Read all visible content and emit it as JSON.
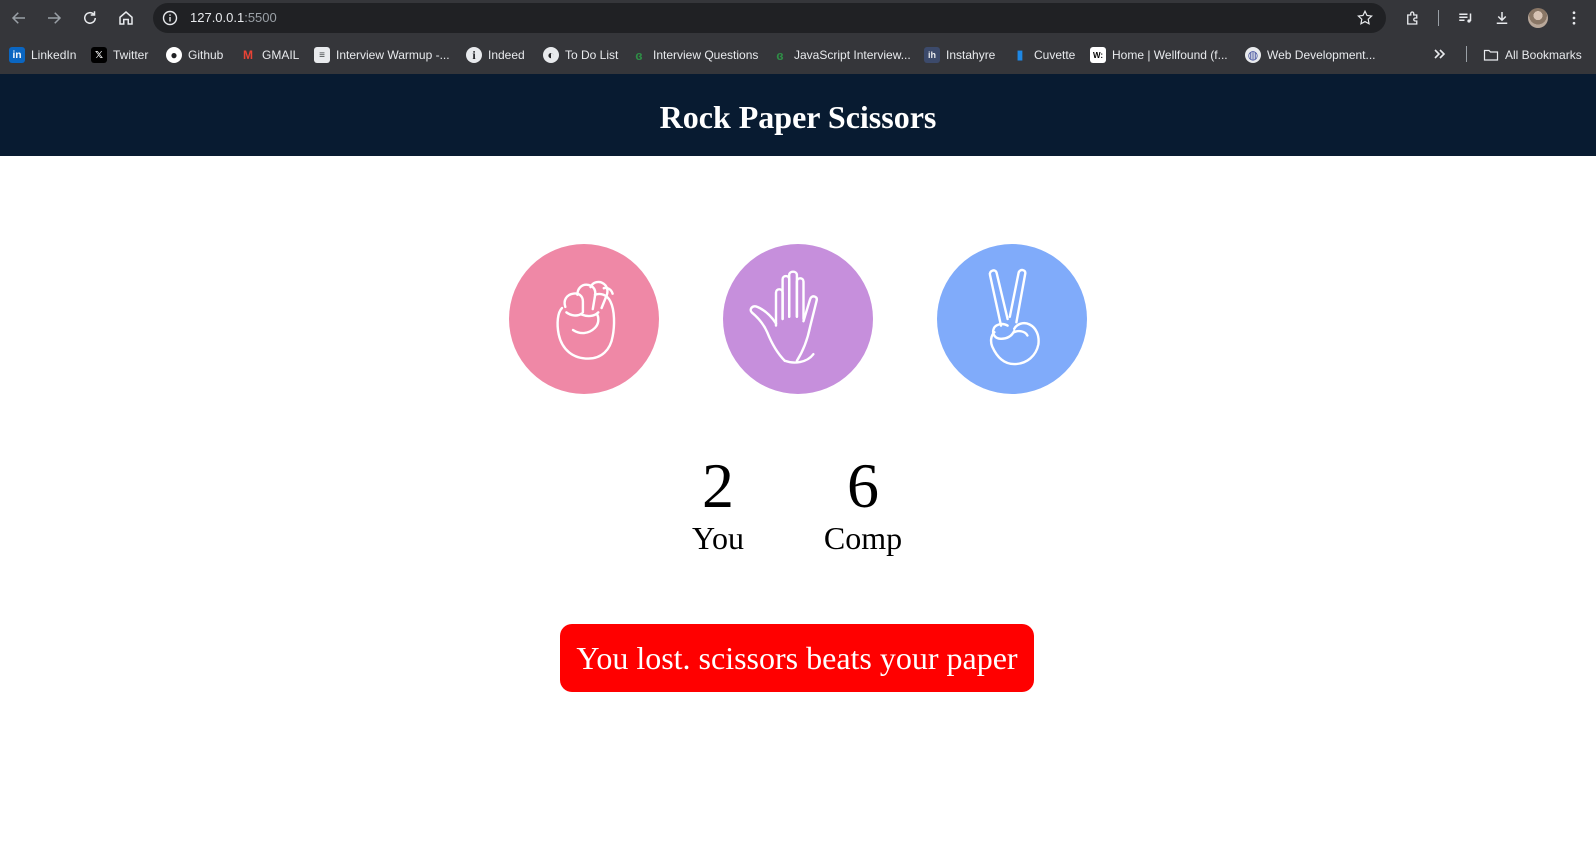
{
  "browser": {
    "url_host": "127.0.0.1",
    "url_port": ":5500",
    "bookmarks": [
      {
        "label": "LinkedIn",
        "icon": "linkedin-icon",
        "color": "#0a66c2",
        "glyph": "in"
      },
      {
        "label": "Twitter",
        "icon": "x-twitter-icon",
        "color": "#000000",
        "glyph": "𝕏"
      },
      {
        "label": "Github",
        "icon": "github-icon",
        "color": "#ffffff",
        "glyph": "●"
      },
      {
        "label": "GMAIL",
        "icon": "gmail-icon",
        "color": "#ea4335",
        "glyph": "M"
      },
      {
        "label": "Interview Warmup -...",
        "icon": "doc-icon",
        "color": "#e8eaed",
        "glyph": "≡"
      },
      {
        "label": "Indeed",
        "icon": "info-circle-icon",
        "color": "#e8eaed",
        "glyph": "i"
      },
      {
        "label": "To Do List",
        "icon": "globe-icon",
        "color": "#e8eaed",
        "glyph": "◐"
      },
      {
        "label": "Interview Questions",
        "icon": "gfg-icon",
        "color": "#2f8d46",
        "glyph": "ɞ"
      },
      {
        "label": "JavaScript Interview...",
        "icon": "gfg-icon",
        "color": "#2f8d46",
        "glyph": "ɞ"
      },
      {
        "label": "Instahyre",
        "icon": "instahyre-icon",
        "color": "#3c4a6b",
        "glyph": "ih"
      },
      {
        "label": "Cuvette",
        "icon": "cuvette-icon",
        "color": "#1565c0",
        "glyph": "▮"
      },
      {
        "label": "Home | Wellfound (f...",
        "icon": "wellfound-icon",
        "color": "#ffffff",
        "glyph": "W:"
      },
      {
        "label": "Web Development...",
        "icon": "webdev-icon",
        "color": "#e8eaed",
        "glyph": "◍"
      }
    ],
    "all_bookmarks": "All Bookmarks"
  },
  "game": {
    "title": "Rock Paper Scissors",
    "choices": [
      {
        "name": "rock",
        "icon": "fist-icon",
        "color": "#ef88a6"
      },
      {
        "name": "paper",
        "icon": "open-hand-icon",
        "color": "#c68fdc"
      },
      {
        "name": "scissors",
        "icon": "peace-sign-icon",
        "color": "#80abfa"
      }
    ],
    "score": {
      "user": "2",
      "user_label": "You",
      "comp": "6",
      "comp_label": "Comp"
    },
    "message": "You lost. scissors beats your paper",
    "message_color": "#ff0000",
    "header_color": "#081b31"
  }
}
